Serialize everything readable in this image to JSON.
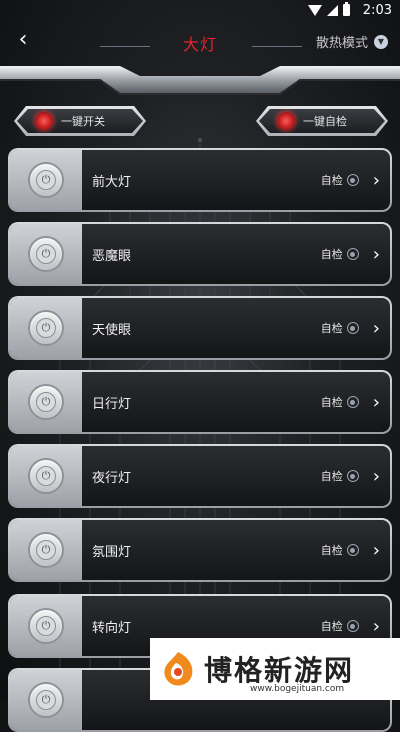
{
  "status": {
    "time": "2:03"
  },
  "header": {
    "back_label": "‹",
    "title": "大灯",
    "mode_label": "散热模式"
  },
  "quick_actions": {
    "switch_label": "一键开关",
    "check_label": "一键自检"
  },
  "lights": [
    {
      "name": "前大灯",
      "check_label": "自检"
    },
    {
      "name": "恶魔眼",
      "check_label": "自检"
    },
    {
      "name": "天使眼",
      "check_label": "自检"
    },
    {
      "name": "日行灯",
      "check_label": "自检"
    },
    {
      "name": "夜行灯",
      "check_label": "自检"
    },
    {
      "name": "氛围灯",
      "check_label": "自检"
    },
    {
      "name": "转向灯",
      "check_label": "自检"
    }
  ],
  "watermark": {
    "text": "博格新游网",
    "url": "www.bogejituan.com"
  },
  "colors": {
    "title_red": "#e3262d",
    "background": "#1e2023"
  }
}
